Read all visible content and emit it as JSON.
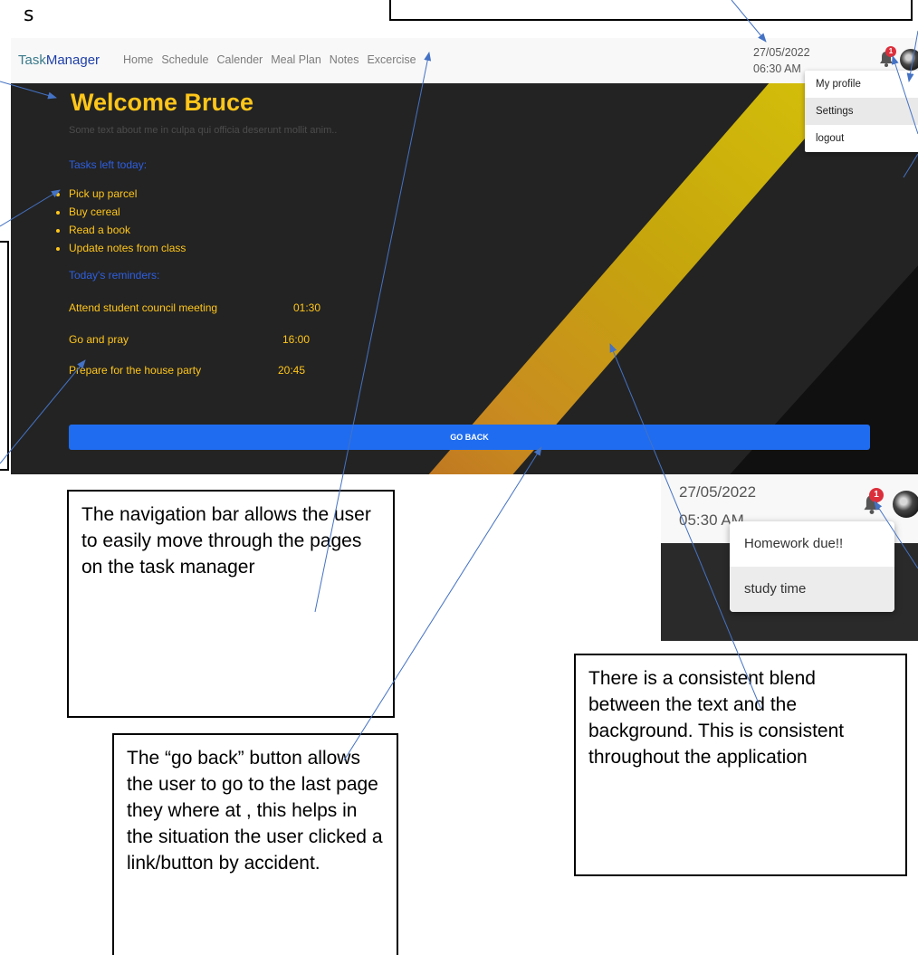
{
  "doc_letter": "s",
  "navbar": {
    "brand_part1": "Task",
    "brand_part2": "Manager",
    "links": [
      "Home",
      "Schedule",
      "Calender",
      "Meal Plan",
      "Notes",
      "Excercise"
    ],
    "date": "27/05/2022",
    "time": "06:30 AM",
    "notification_count": "1"
  },
  "profile_menu": {
    "items": [
      "My profile",
      "Settings",
      "logout"
    ]
  },
  "main": {
    "welcome": "Welcome Bruce",
    "subtext": "Some text about me in culpa qui officia deserunt mollit anim..",
    "tasks_heading": "Tasks left today:",
    "tasks": [
      "Pick up parcel",
      "Buy cereal",
      "Read a book",
      "Update notes from class"
    ],
    "reminders_heading": "Today's reminders:",
    "reminders": [
      {
        "label": "Attend student council meeting",
        "time": "01:30"
      },
      {
        "label": "Go and pray",
        "time": "16:00"
      },
      {
        "label": "Prepare for the house party",
        "time": "20:45"
      }
    ],
    "go_back_label": "GO BACK"
  },
  "inset": {
    "date": "27/05/2022",
    "time": "05:30 AM",
    "notification_count": "1",
    "notifications": [
      "Homework due!!",
      "study time"
    ]
  },
  "annotations": {
    "navbar_note": "The navigation bar allows the user to easily move through the pages on the task manager",
    "goback_note": "The “go back” button allows the user to go to the last page they where at , this helps in the situation the user clicked a link/button by accident.",
    "blend_note": "There is a consistent blend between the text and the background. This is consistent throughout the application"
  },
  "colors": {
    "accent_yellow": "#ffc61a",
    "accent_blue": "#2e5fe0",
    "button_blue": "#1f6cf0",
    "badge_red": "#dc2f3c",
    "annotation_arrow": "#4472c4"
  }
}
